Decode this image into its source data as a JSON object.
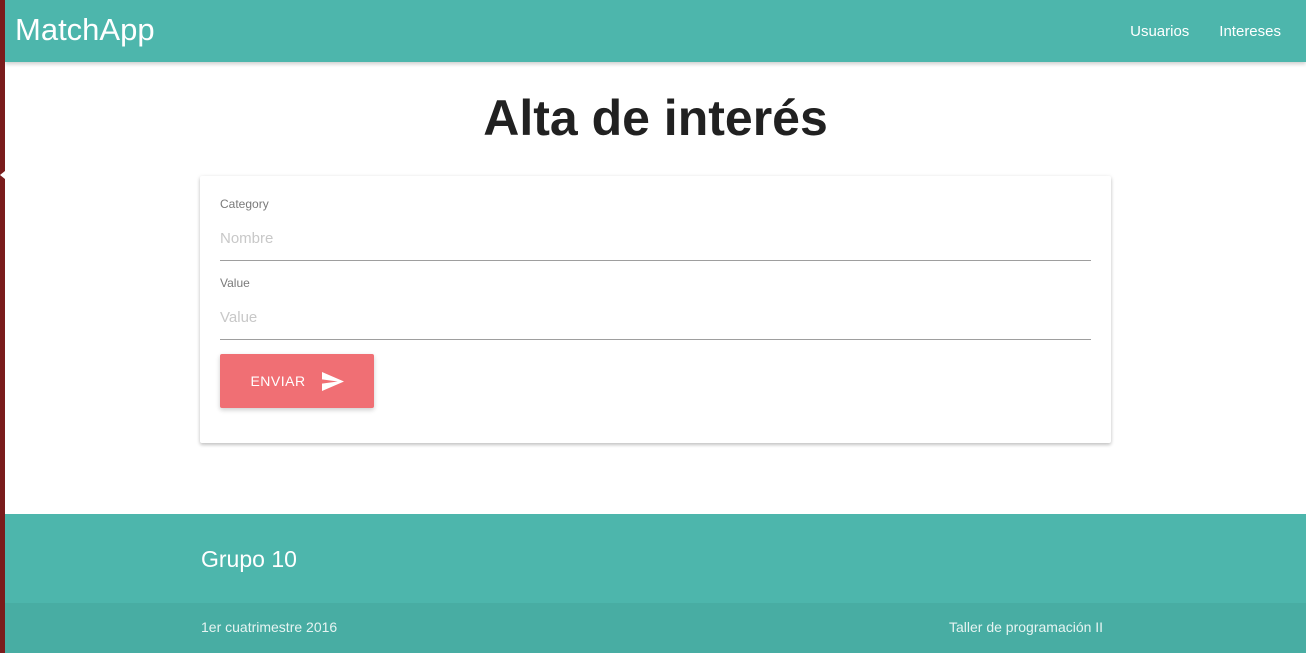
{
  "navbar": {
    "brand": "MatchApp",
    "links": [
      "Usuarios",
      "Intereses"
    ]
  },
  "page": {
    "title": "Alta de interés"
  },
  "form": {
    "category": {
      "label": "Category",
      "placeholder": "Nombre",
      "value": ""
    },
    "value": {
      "label": "Value",
      "placeholder": "Value",
      "value": ""
    },
    "submit_label": "ENVIAR",
    "submit_icon": "send-icon"
  },
  "footer": {
    "title": "Grupo 10",
    "left_text": "1er cuatrimestre 2016",
    "right_text": "Taller de programación II"
  },
  "colors": {
    "primary": "#4db6ac",
    "accent": "#f06f74",
    "footer_bottom": "#48ada3"
  }
}
